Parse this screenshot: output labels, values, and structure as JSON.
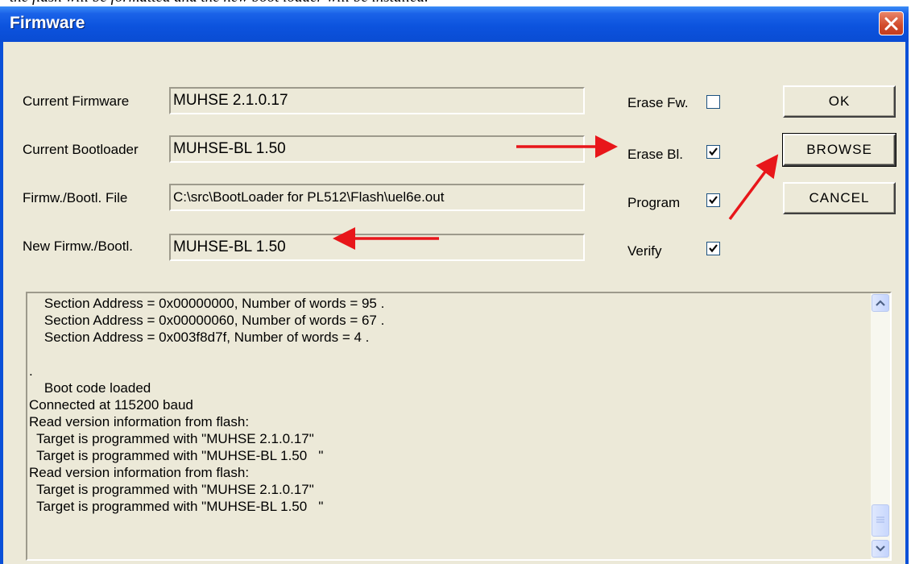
{
  "top_text": "the flash will be formatted and the new boot loader will be installed.",
  "window": {
    "title": "Firmware"
  },
  "fields": [
    {
      "label": "Current Firmware",
      "value": "MUHSE 2.1.0.17"
    },
    {
      "label": "Current Bootloader",
      "value": "MUHSE-BL 1.50"
    },
    {
      "label": "Firmw./Bootl. File",
      "value": "C:\\src\\BootLoader for PL512\\Flash\\uel6e.out"
    },
    {
      "label": "New Firmw./Bootl.",
      "value": "MUHSE-BL 1.50"
    }
  ],
  "options": [
    {
      "label": "Erase Fw.",
      "checked": false
    },
    {
      "label": "Erase Bl.",
      "checked": true
    },
    {
      "label": "Program",
      "checked": true
    },
    {
      "label": "Verify",
      "checked": true
    }
  ],
  "buttons": {
    "ok": "OK",
    "browse": "BROWSE",
    "cancel": "CANCEL"
  },
  "log": {
    "lines": [
      "    Section Address = 0x00000000, Number of words = 95 .",
      "    Section Address = 0x00000060, Number of words = 67 .",
      "    Section Address = 0x003f8d7f, Number of words = 4 .",
      "",
      ".",
      "    Boot code loaded",
      "Connected at 115200 baud",
      "Read version information from flash:",
      "  Target is programmed with \"MUHSE 2.1.0.17\"",
      "  Target is programmed with \"MUHSE-BL 1.50   \"",
      "Read version information from flash:",
      "  Target is programmed with \"MUHSE 2.1.0.17\"",
      "  Target is programmed with \"MUHSE-BL 1.50   \""
    ]
  },
  "colors": {
    "annotation_arrow": "#e8161a",
    "titlebar": "#0c53de"
  }
}
